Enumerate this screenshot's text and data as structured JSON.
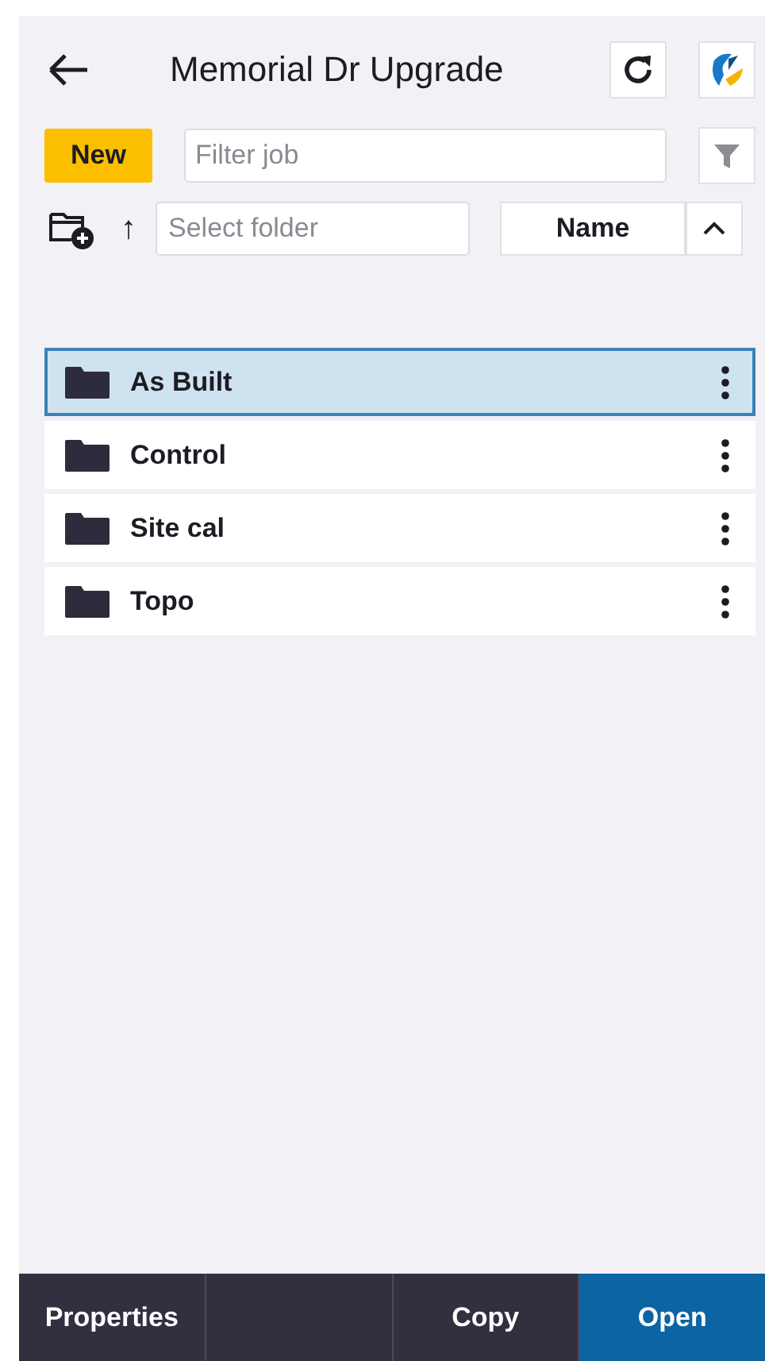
{
  "header": {
    "title": "Memorial Dr Upgrade"
  },
  "toolbar": {
    "new_button": "New",
    "filter": {
      "placeholder": "Filter job"
    }
  },
  "folder_bar": {
    "up_icon": "↑",
    "folder": {
      "placeholder": "Select folder"
    },
    "sort_button": "Name"
  },
  "folders": [
    {
      "name": "As Built",
      "selected": true
    },
    {
      "name": "Control",
      "selected": false
    },
    {
      "name": "Site cal",
      "selected": false
    },
    {
      "name": "Topo",
      "selected": false
    }
  ],
  "footer_buttons": [
    {
      "label": "Properties",
      "kind": "plain"
    },
    {
      "kind": "blank"
    },
    {
      "label": "Copy",
      "kind": "plain"
    },
    {
      "label": "Open",
      "kind": "primary"
    }
  ]
}
